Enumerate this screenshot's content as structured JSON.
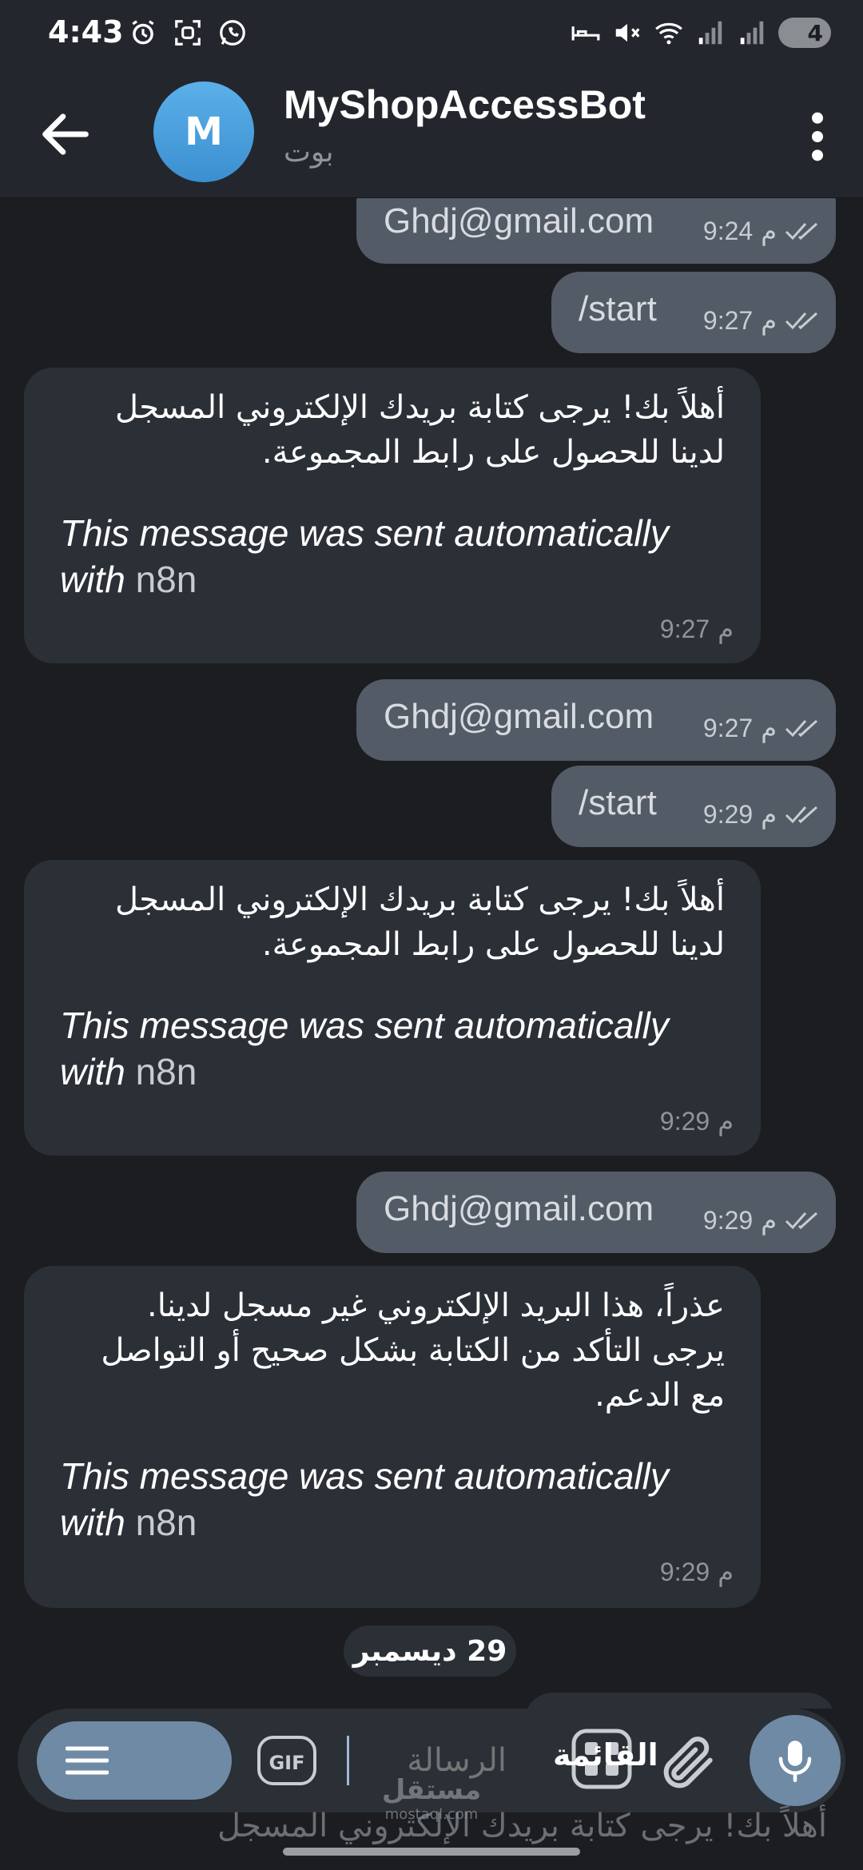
{
  "status_bar": {
    "time": "4:43",
    "battery": "4",
    "icons_left": [
      "alarm-icon",
      "screenshot-icon",
      "whatsapp-icon"
    ],
    "icons_right": [
      "bed-icon",
      "mute-icon",
      "wifi-icon",
      "signal-icon",
      "signal-icon"
    ]
  },
  "header": {
    "avatar_letter": "M",
    "title": "MyShopAccessBot",
    "subtitle": "بوت"
  },
  "messages": [
    {
      "type": "out",
      "text": "Ghdj@gmail.com",
      "time": "9:24",
      "ampm": "م"
    },
    {
      "type": "out",
      "text": "/start",
      "time": "9:27",
      "ampm": "م"
    },
    {
      "type": "in",
      "ar_line1": "أهلاً بك! يرجى كتابة بريدك الإلكتروني المسجل",
      "ar_line2": "لدينا للحصول على رابط المجموعة.",
      "en_line1": "This message was sent automatically",
      "en_with": "with",
      "en_n8n": "n8n",
      "time": "9:27",
      "ampm": "م"
    },
    {
      "type": "out",
      "text": "Ghdj@gmail.com",
      "time": "9:27",
      "ampm": "م"
    },
    {
      "type": "out",
      "text": "/start",
      "time": "9:29",
      "ampm": "م"
    },
    {
      "type": "in",
      "ar_line1": "أهلاً بك! يرجى كتابة بريدك الإلكتروني المسجل",
      "ar_line2": "لدينا للحصول على رابط المجموعة.",
      "en_line1": "This message was sent automatically",
      "en_with": "with",
      "en_n8n": "n8n",
      "time": "9:29",
      "ampm": "م"
    },
    {
      "type": "out",
      "text": "Ghdj@gmail.com",
      "time": "9:29",
      "ampm": "م"
    },
    {
      "type": "in",
      "ar_line1": "عذراً، هذا البريد الإلكتروني غير مسجل لدينا.",
      "ar_line2": "يرجى التأكد من الكتابة بشكل صحيح أو التواصل",
      "ar_line3": "مع الدعم.",
      "en_line1": "This message was sent automatically",
      "en_with": "with",
      "en_n8n": "n8n",
      "time": "9:29",
      "ampm": "م"
    }
  ],
  "date_separator": "29 ديسمبر",
  "input_bar": {
    "placeholder": "الرسالة",
    "gif_label": "GIF",
    "keyboard_label": "القائمة"
  },
  "partial_message": "أهلاً بك! يرجى كتابة بريدك الإلكتروني المسجل",
  "watermark": {
    "ar": "مستقل",
    "en": "mostaql.com"
  }
}
